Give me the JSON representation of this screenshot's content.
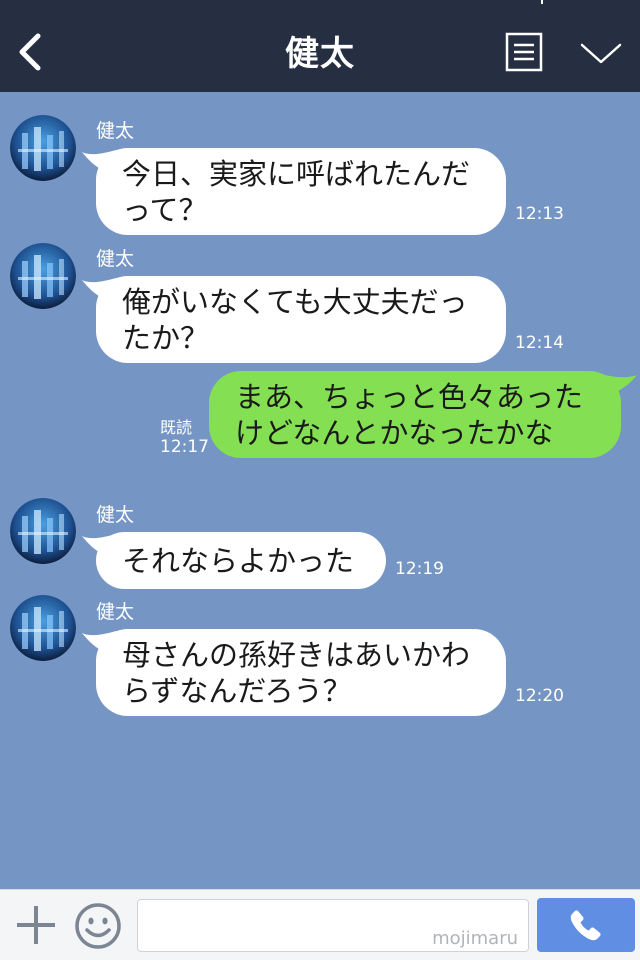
{
  "header": {
    "title": "健太",
    "back_icon": "chevron-left-icon",
    "menu_icon": "menu-list-icon",
    "collapse_icon": "chevron-down-icon"
  },
  "colors": {
    "header_bg": "#262e41",
    "chat_bg": "#7596c5",
    "incoming_bubble": "#ffffff",
    "outgoing_bubble": "#84e052",
    "send_button": "#5f8ee3"
  },
  "messages": [
    {
      "direction": "incoming",
      "sender": "健太",
      "lines": [
        "今日、実家に呼ばれたんだ",
        "って？"
      ],
      "time": "12:13"
    },
    {
      "direction": "incoming",
      "sender": "健太",
      "lines": [
        "俺がいなくても大丈夫だっ",
        "たか？"
      ],
      "time": "12:14"
    },
    {
      "direction": "outgoing",
      "read_label": "既読",
      "time": "12:17",
      "lines": [
        "まあ、ちょっと色々あった",
        "けどなんとかなったかな"
      ]
    },
    {
      "direction": "incoming",
      "sender": "健太",
      "lines": [
        "それならよかった"
      ],
      "time": "12:19"
    },
    {
      "direction": "incoming",
      "sender": "健太",
      "lines": [
        "母さんの孫好きはあいかわ",
        "らずなんだろう？"
      ],
      "time": "12:20"
    }
  ],
  "input_bar": {
    "placeholder": "",
    "watermark": "mojimaru",
    "plus_icon": "plus-icon",
    "emoji_icon": "smiley-icon",
    "call_icon": "phone-icon"
  }
}
